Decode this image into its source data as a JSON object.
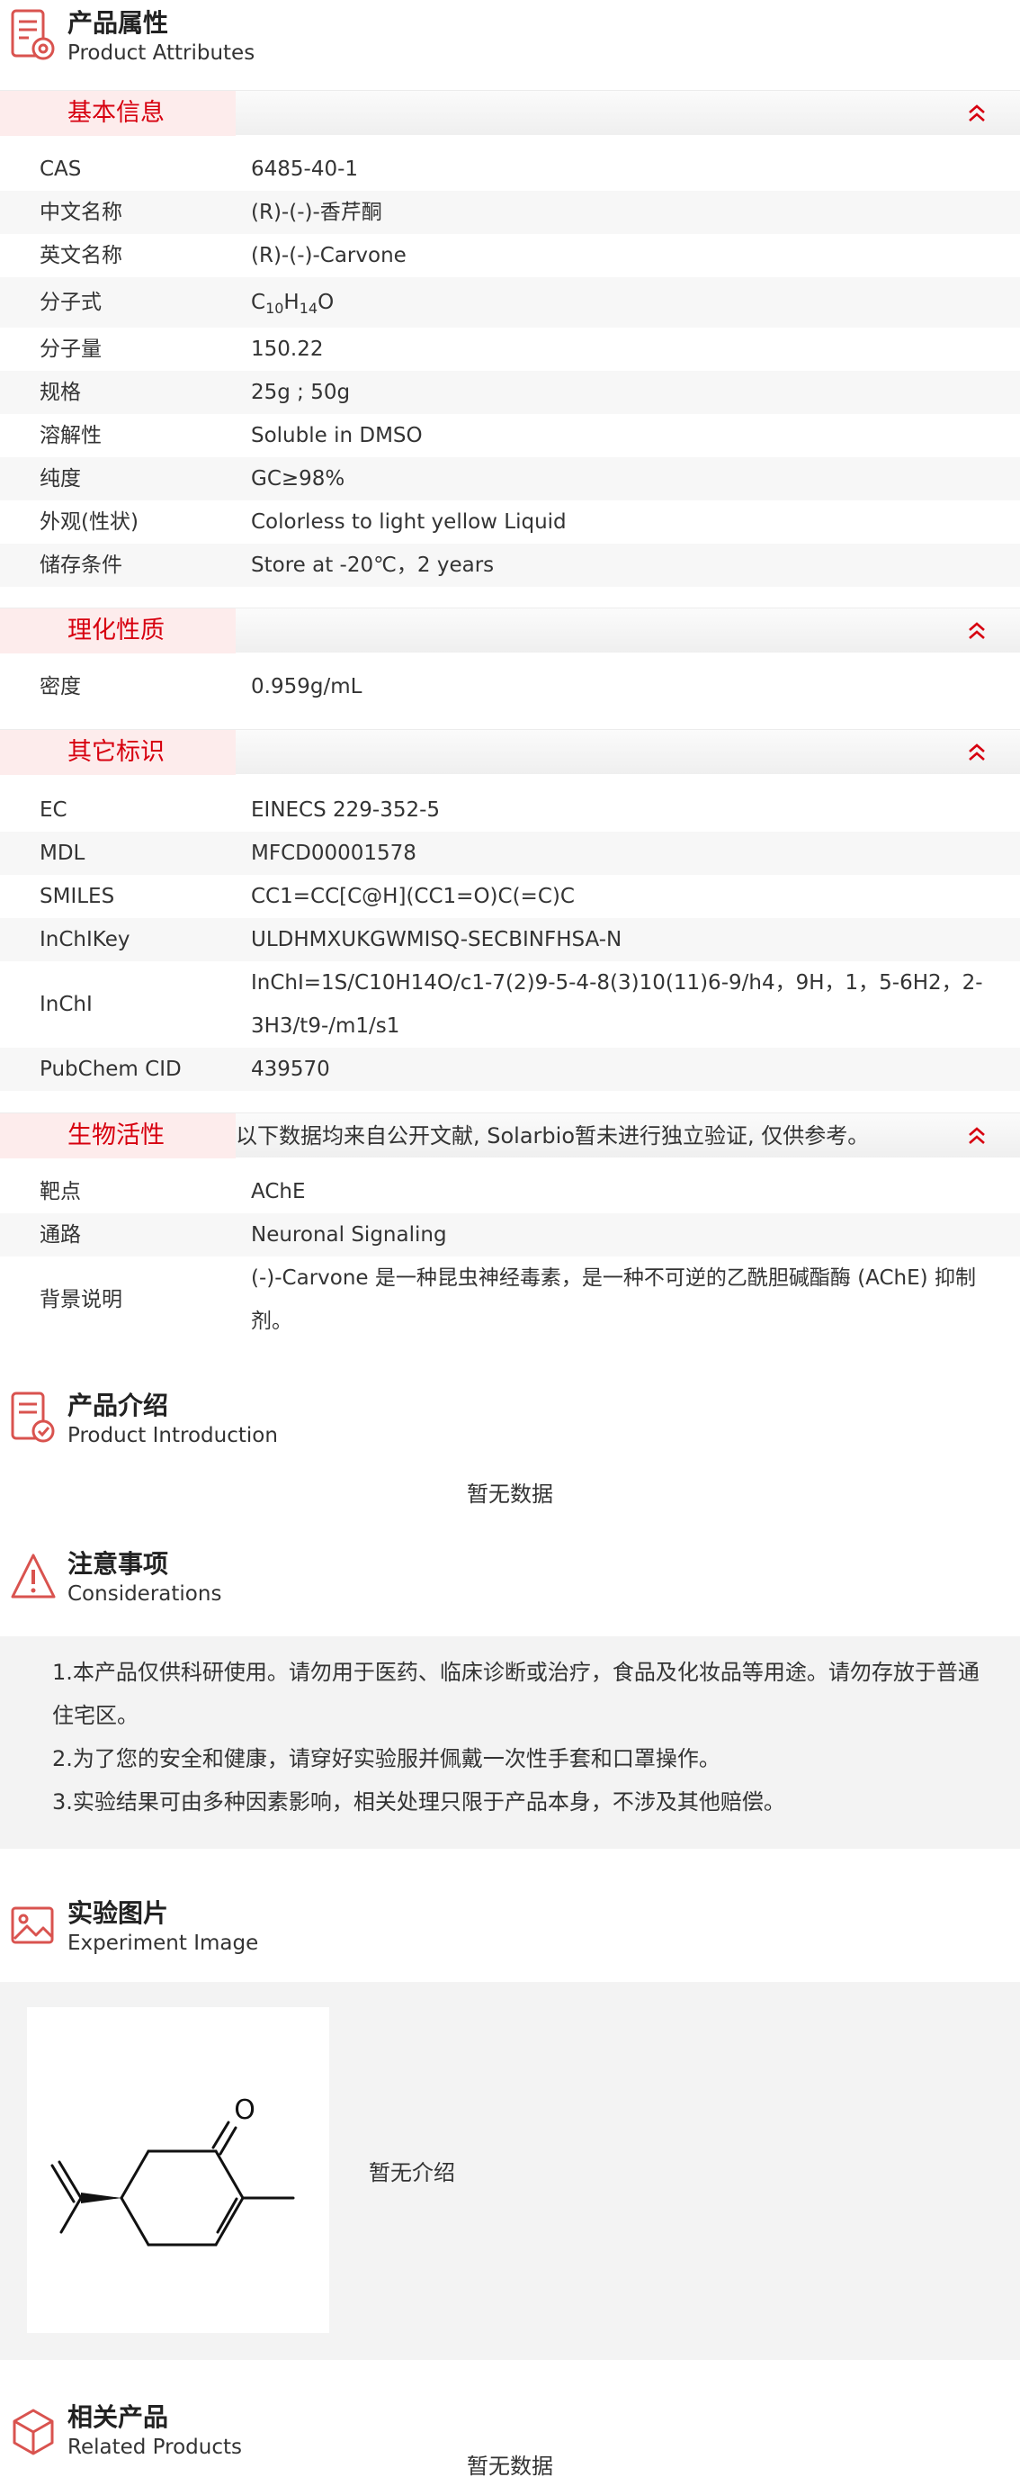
{
  "attributes": {
    "title_cn": "产品属性",
    "title_en": "Product Attributes",
    "basic": {
      "title": "基本信息",
      "rows": [
        {
          "label": "CAS",
          "value": "6485-40-1"
        },
        {
          "label": "中文名称",
          "value": "(R)-(-)-香芹酮"
        },
        {
          "label": "英文名称",
          "value": "(R)-(-)-Carvone"
        },
        {
          "label": "分子式",
          "formula": {
            "c": "C",
            "c_n": "10",
            "h": "H",
            "h_n": "14",
            "o": "O"
          }
        },
        {
          "label": "分子量",
          "value": "150.22"
        },
        {
          "label": "规格",
          "value": "25g ; 50g"
        },
        {
          "label": "溶解性",
          "value": "Soluble in DMSO"
        },
        {
          "label": "纯度",
          "value": "GC≥98%"
        },
        {
          "label": "外观(性状)",
          "value": "Colorless to light yellow Liquid"
        },
        {
          "label": "储存条件",
          "value": "Store at -20℃，2 years"
        }
      ]
    },
    "physchem": {
      "title": "理化性质",
      "rows": [
        {
          "label": "密度",
          "value": "0.959g/mL"
        }
      ]
    },
    "other": {
      "title": "其它标识",
      "rows": [
        {
          "label": "EC",
          "value": "EINECS 229-352-5"
        },
        {
          "label": "MDL",
          "value": "MFCD00001578"
        },
        {
          "label": "SMILES",
          "value": "CC1=CC[C@H](CC1=O)C(=C)C"
        },
        {
          "label": "InChIKey",
          "value": "ULDHMXUKGWMISQ-SECBINFHSA-N"
        },
        {
          "label": "InChI",
          "value": "InChI=1S/C10H14O/c1-7(2)9-5-4-8(3)10(11)6-9/h4，9H，1，5-6H2，2-3H3/t9-/m1/s1"
        },
        {
          "label": "PubChem CID",
          "value": "439570"
        }
      ]
    },
    "bio": {
      "title": "生物活性",
      "note": "以下数据均来自公开文献, Solarbio暂未进行独立验证, 仅供参考。",
      "rows": [
        {
          "label": "靶点",
          "value": "AChE"
        },
        {
          "label": "通路",
          "value": "Neuronal Signaling"
        },
        {
          "label": "背景说明",
          "value": "(-)-Carvone 是一种昆虫神经毒素，是一种不可逆的乙酰胆碱酯酶 (AChE) 抑制剂。"
        }
      ]
    }
  },
  "introduction": {
    "title_cn": "产品介绍",
    "title_en": "Product Introduction",
    "empty_text": "暂无数据"
  },
  "considerations": {
    "title_cn": "注意事项",
    "title_en": "Considerations",
    "items": [
      "1.本产品仅供科研使用。请勿用于医药、临床诊断或治疗，食品及化妆品等用途。请勿存放于普通住宅区。",
      "2.为了您的安全和健康，请穿好实验服并佩戴一次性手套和口罩操作。",
      "3.实验结果可由多种因素影响，相关处理只限于产品本身，不涉及其他赔偿。"
    ]
  },
  "experiment": {
    "title_cn": "实验图片",
    "title_en": "Experiment Image",
    "structure_atom_label": "O",
    "note": "暂无介绍"
  },
  "related": {
    "title_cn": "相关产品",
    "title_en": "Related Products",
    "empty_text": "暂无数据"
  },
  "colors": {
    "accent": "#d7000f",
    "band_tab": "#fdecec",
    "row_alt": "#f7f7f7",
    "panel_gray": "#f3f3f3"
  },
  "icons": {
    "attributes": "document-gear-icon",
    "introduction": "document-check-icon",
    "considerations": "warning-triangle-icon",
    "experiment": "image-icon",
    "related": "box-icon",
    "collapse": "double-chevron-up-icon"
  }
}
